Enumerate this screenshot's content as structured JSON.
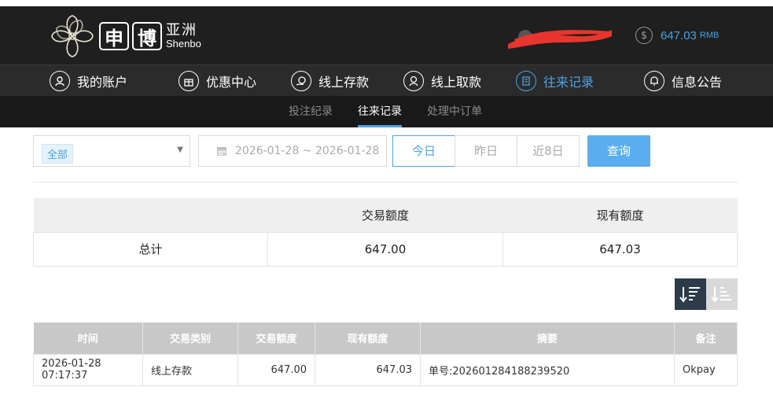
{
  "header": {
    "logo_box1": "申",
    "logo_box2": "博",
    "logo_cn": "亚洲",
    "logo_en": "Shenbo",
    "balance": {
      "amount": "647.03",
      "currency": "RMB"
    }
  },
  "nav": {
    "items": [
      {
        "label": "我的账户",
        "icon": "user-icon"
      },
      {
        "label": "优惠中心",
        "icon": "gift-icon"
      },
      {
        "label": "线上存款",
        "icon": "deposit-icon"
      },
      {
        "label": "线上取款",
        "icon": "withdraw-icon"
      },
      {
        "label": "往来记录",
        "icon": "records-icon",
        "active": true
      },
      {
        "label": "信息公告",
        "icon": "bell-icon"
      }
    ]
  },
  "subnav": {
    "items": [
      {
        "label": "投注纪录"
      },
      {
        "label": "往来记录",
        "active": true
      },
      {
        "label": "处理中订单"
      }
    ]
  },
  "filters": {
    "type_selected": "全部",
    "date_range": "2026-01-28 ~ 2026-01-28",
    "quick": [
      "今日",
      "昨日",
      "近8日"
    ],
    "query_label": "查询"
  },
  "summary": {
    "headers": [
      "",
      "交易额度",
      "现有额度"
    ],
    "row": [
      "总计",
      "647.00",
      "647.03"
    ]
  },
  "detail": {
    "headers": [
      "时间",
      "交易类别",
      "交易额度",
      "现有额度",
      "摘要",
      "备注"
    ],
    "rows": [
      [
        "2026-01-28 07:17:37",
        "线上存款",
        "647.00",
        "647.03",
        "单号:202601284188239520",
        "Okpay"
      ]
    ]
  },
  "colors": {
    "accent": "#4aa3e6",
    "header_bg": "#1f1f1f",
    "nav_bg": "#2b2b2b",
    "subnav_bg": "#191919"
  }
}
